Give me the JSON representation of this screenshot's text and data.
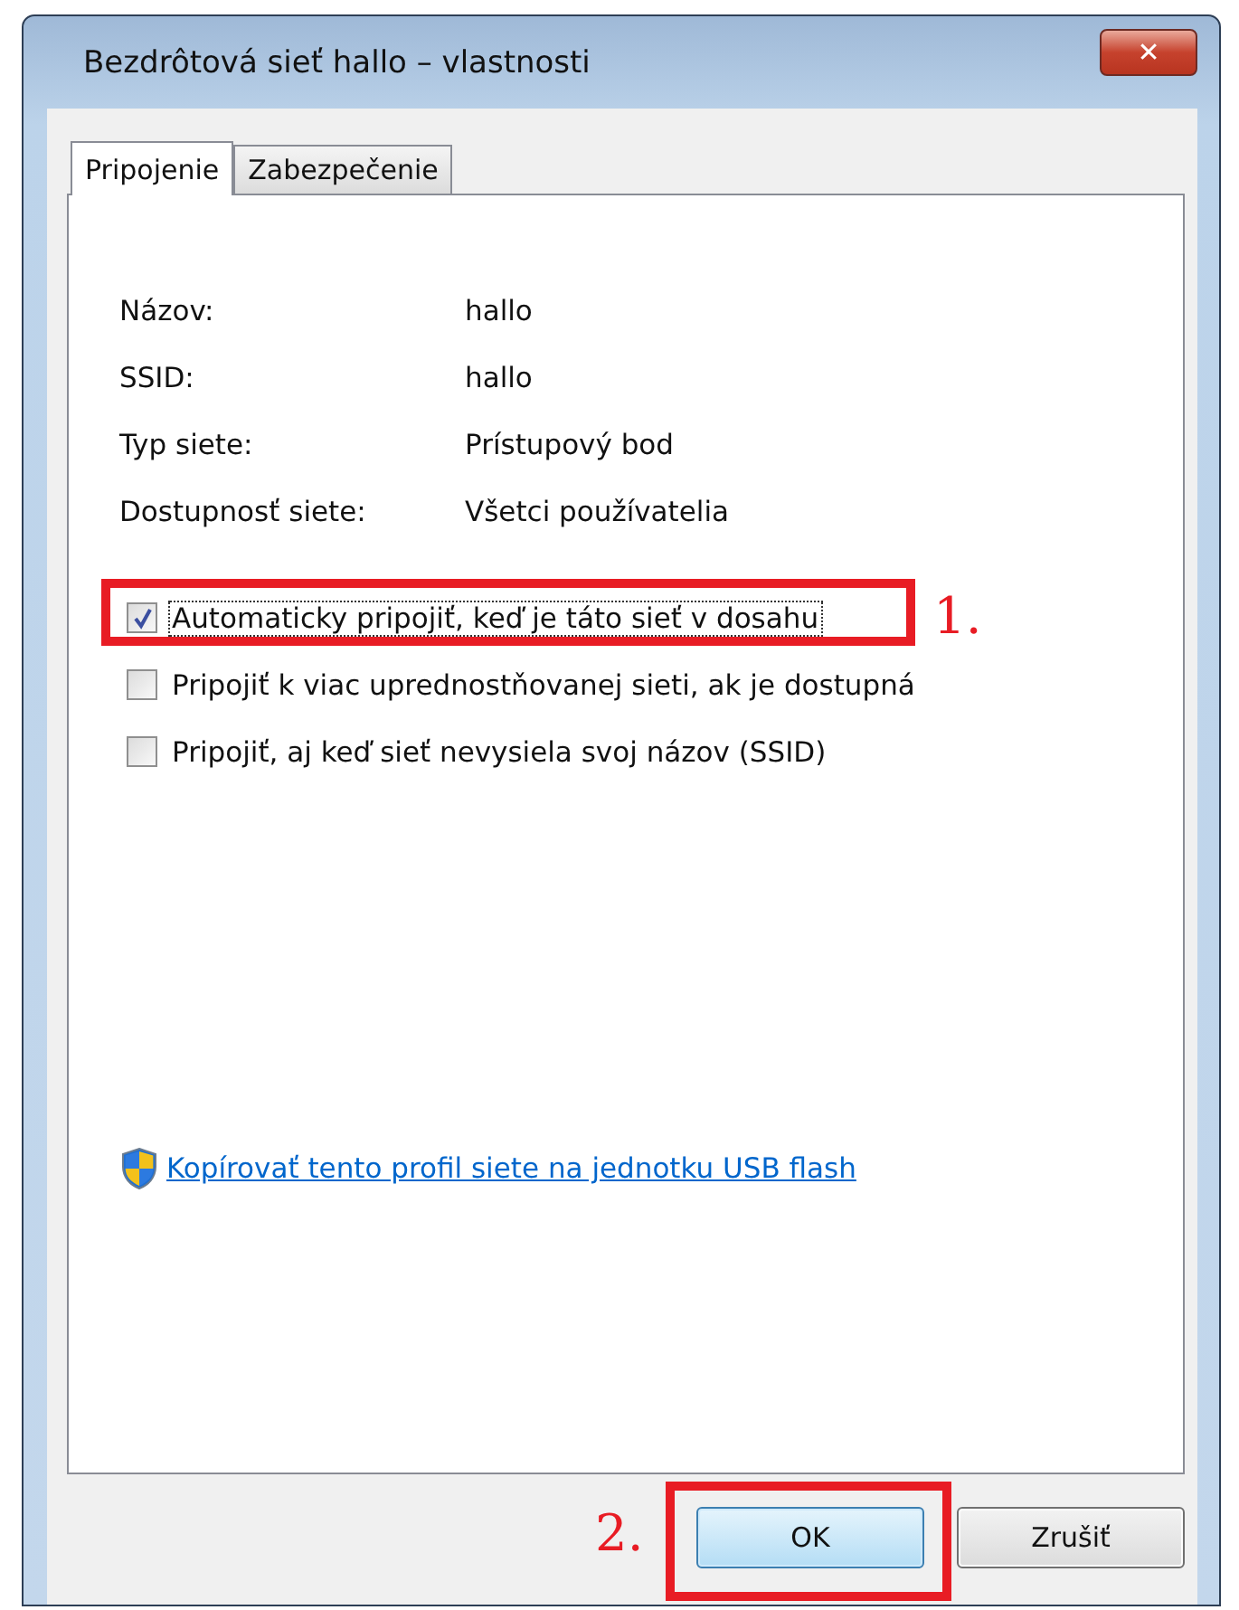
{
  "window": {
    "title": "Bezdrôtová sieť hallo – vlastnosti",
    "close": "✕"
  },
  "tabs": [
    {
      "label": "Pripojenie",
      "selected": true
    },
    {
      "label": "Zabezpečenie",
      "selected": false
    }
  ],
  "properties": [
    {
      "label": "Názov:",
      "value": "hallo"
    },
    {
      "label": "SSID:",
      "value": "hallo"
    },
    {
      "label": "Typ siete:",
      "value": "Prístupový bod"
    },
    {
      "label": "Dostupnosť siete:",
      "value": "Všetci používatelia"
    }
  ],
  "checkboxes": [
    {
      "label": "Automaticky pripojiť, keď je táto sieť v dosahu",
      "checked": true,
      "focused": true,
      "annotation": "1."
    },
    {
      "label": "Pripojiť k viac uprednostňovanej sieti, ak je dostupná",
      "checked": false,
      "focused": false
    },
    {
      "label": "Pripojiť, aj keď sieť nevysiela svoj názov (SSID)",
      "checked": false,
      "focused": false
    }
  ],
  "link": {
    "text": "Kopírovať tento profil siete na jednotku USB flash"
  },
  "buttons": [
    {
      "label": "OK",
      "default": true,
      "annotation": "2."
    },
    {
      "label": "Zrušiť",
      "default": false
    }
  ]
}
